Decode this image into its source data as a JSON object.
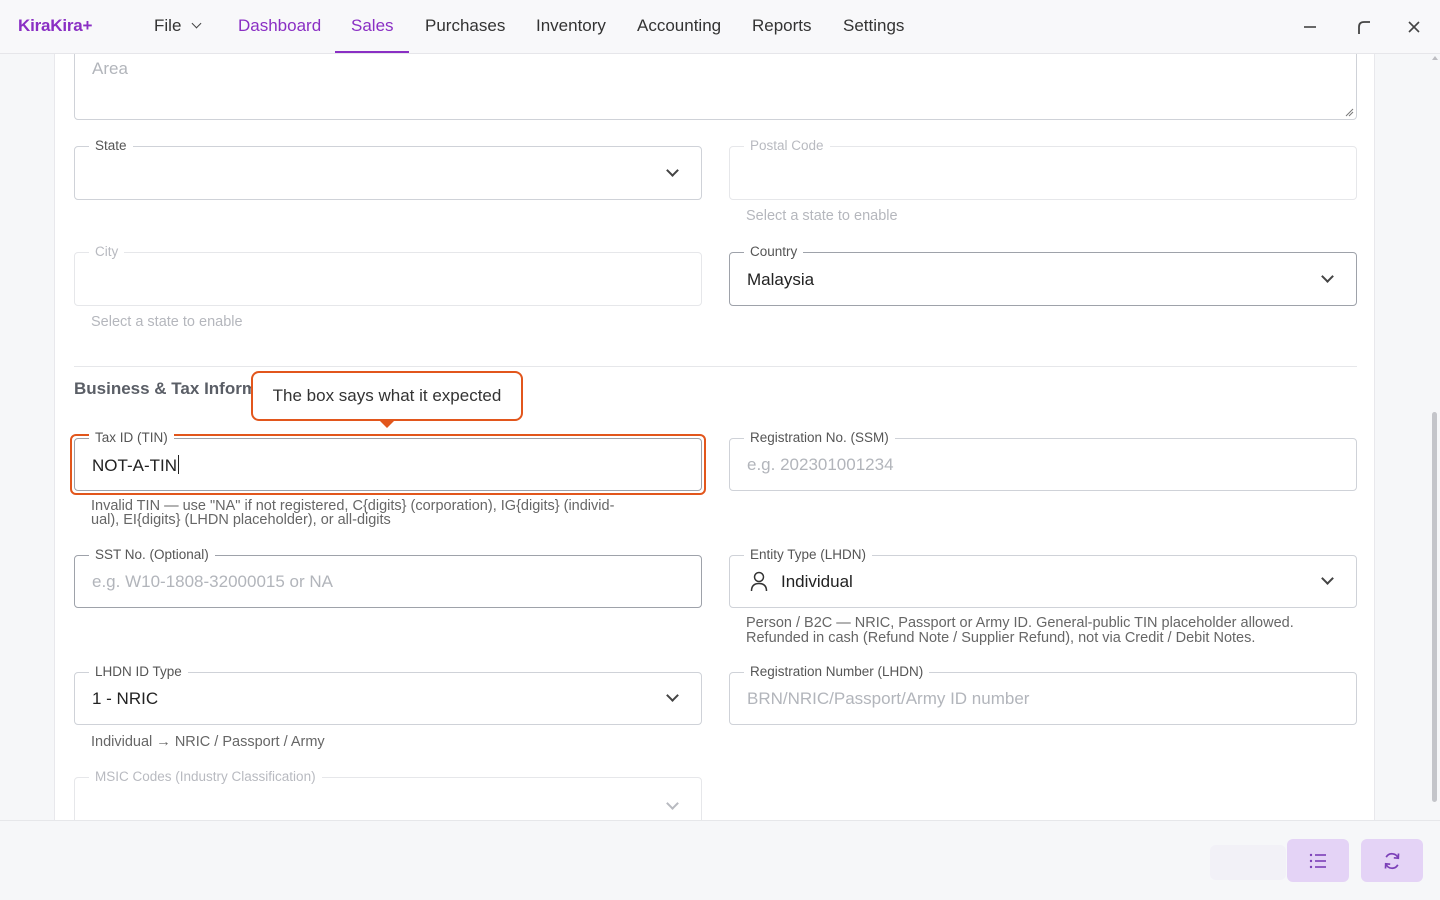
{
  "app": {
    "brand": "KiraKira+",
    "menu": {
      "file": "File",
      "dashboard": "Dashboard",
      "sales": "Sales",
      "purchases": "Purchases",
      "inventory": "Inventory",
      "accounting": "Accounting",
      "reports": "Reports",
      "settings": "Settings"
    },
    "active_tab": "Sales",
    "window_controls": [
      "minimize-icon",
      "restore-icon",
      "close-icon"
    ]
  },
  "form": {
    "area": {
      "placeholder": "Area"
    },
    "state": {
      "label": "State",
      "value": ""
    },
    "postal_code": {
      "label": "Postal Code",
      "value": "",
      "helper": "Select a state to enable"
    },
    "city": {
      "label": "City",
      "value": "",
      "helper": "Select a state to enable"
    },
    "country": {
      "label": "Country",
      "value": "Malaysia"
    },
    "business_section": {
      "title": "Business & Tax Inform"
    },
    "tax_id": {
      "label": "Tax ID (TIN)",
      "value": "NOT-A-TIN",
      "error_line1": "Invalid TIN — use \"NA\" if not registered, C{digits} (corporation), IG{digits} (individ-",
      "error_line2": "ual), EI{digits} (LHDN placeholder), or all-digits"
    },
    "registration_ssm": {
      "label": "Registration No. (SSM)",
      "placeholder": "e.g. 202301001234"
    },
    "sst": {
      "label": "SST No. (Optional)",
      "placeholder": "e.g. W10-1808-32000015 or NA"
    },
    "entity_type": {
      "label": "Entity Type (LHDN)",
      "value": "Individual",
      "icon": "person-icon",
      "helper_line1": "Person / B2C — NRIC, Passport or Army ID. General-public TIN placeholder allowed.",
      "helper_line2": "Refunded in cash (Refund Note / Supplier Refund), not via Credit / Debit Notes."
    },
    "lhdn_id_type": {
      "label": "LHDN ID Type",
      "value": "1 - NRIC",
      "helper": "Individual → NRIC / Passport / Army"
    },
    "registration_lhdn": {
      "label": "Registration Number (LHDN)",
      "placeholder": "BRN/NRIC/Passport/Army ID number"
    },
    "msic": {
      "label": "MSIC Codes (Industry Classification)",
      "value": ""
    }
  },
  "tooltip": {
    "text": "The box says what it expected",
    "accent": "#e2561c"
  },
  "footer": {
    "buttons": [
      "list-icon",
      "refresh-icon"
    ]
  },
  "colors": {
    "brand": "#8a2fc4",
    "error": "#e2561c",
    "fab_bg": "#e4d3f6"
  }
}
